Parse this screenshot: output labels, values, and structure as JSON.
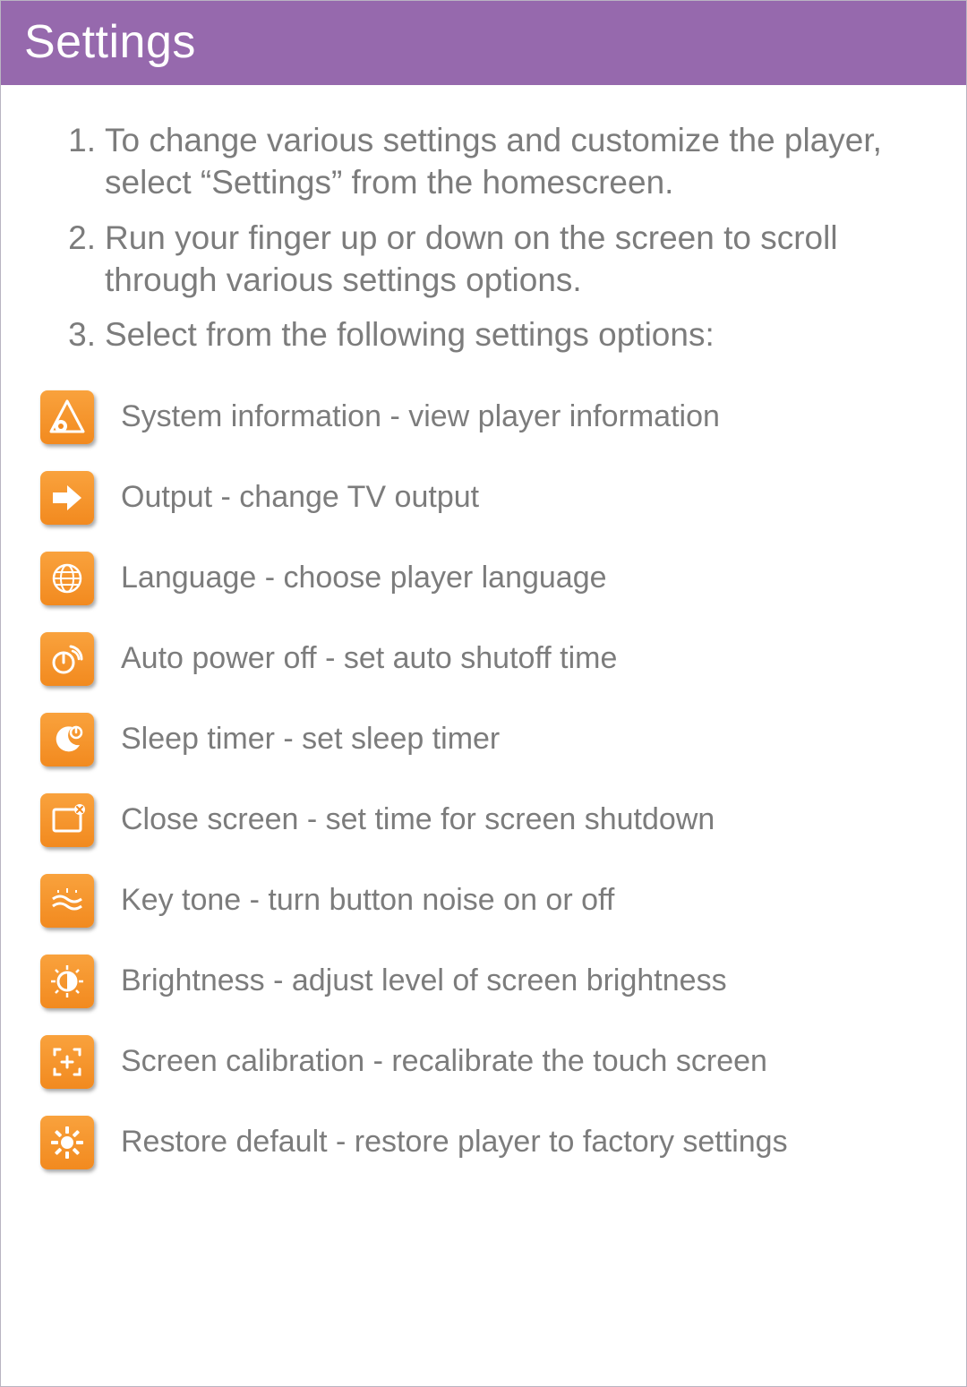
{
  "header": {
    "title": "Settings"
  },
  "steps": [
    {
      "num": "1.",
      "text": "To change various settings and customize the player,  select “Settings” from the homescreen."
    },
    {
      "num": "2.",
      "text": "Run your finger up or down on the screen to scroll through various settings options."
    },
    {
      "num": "3.",
      "text": "Select from the following settings options:"
    }
  ],
  "options": [
    {
      "icon": "system-info-icon",
      "label": "System information - view player information"
    },
    {
      "icon": "output-icon",
      "label": "Output - change TV output"
    },
    {
      "icon": "language-icon",
      "label": "Language - choose player language"
    },
    {
      "icon": "auto-power-icon",
      "label": "Auto power off - set auto shutoff time"
    },
    {
      "icon": "sleep-timer-icon",
      "label": "Sleep timer - set sleep timer"
    },
    {
      "icon": "close-screen-icon",
      "label": "Close screen - set time for screen shutdown"
    },
    {
      "icon": "key-tone-icon",
      "label": "Key tone - turn button noise on or off"
    },
    {
      "icon": "brightness-icon",
      "label": "Brightness - adjust level of screen brightness"
    },
    {
      "icon": "calibration-icon",
      "label": "Screen calibration - recalibrate the touch screen"
    },
    {
      "icon": "restore-icon",
      "label": "Restore default - restore player to factory settings"
    }
  ]
}
